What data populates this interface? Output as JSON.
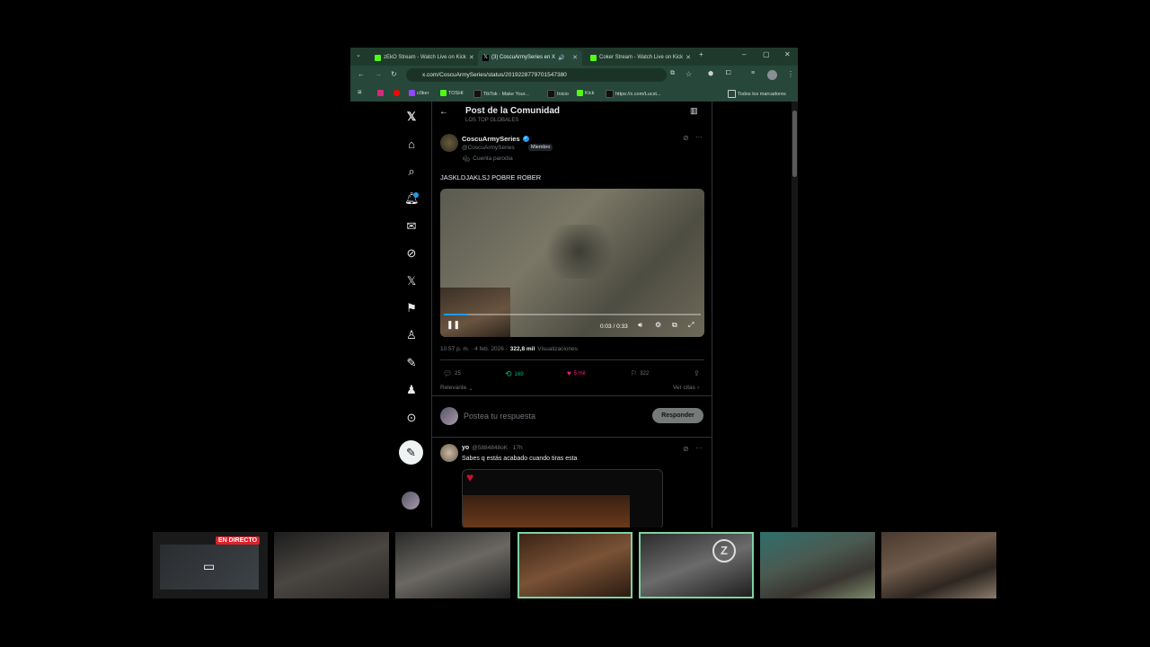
{
  "browser": {
    "tabs": [
      {
        "title": "zEkO Stream - Watch Live on Kick",
        "icon": "kick-icon",
        "active": false
      },
      {
        "title": "(3) CoscuArmySeries en X",
        "icon": "x-logo-icon",
        "active": true
      },
      {
        "title": "Coker Stream - Watch Live on Kick",
        "icon": "kick-icon",
        "active": false
      }
    ],
    "url": "x.com/CoscuArmySeries/status/2019228779701547380",
    "bookmarks": [
      "c0ker",
      "TOSHI",
      "TikTok - Make Your...",
      "Inicio",
      "Kick",
      "https://x.com/Lucst..."
    ],
    "all_bookmarks": "Todos los marcadores"
  },
  "post": {
    "header_title": "Post de la Comunidad",
    "header_subtitle": "LOS TOP GLOBALES",
    "author_name": "CoscuArmySeries",
    "author_handle": "@CoscuArmySeries",
    "member_badge": "Miembro",
    "parody_label": "Cuenta parodia",
    "text": "JASKLDJAKLSJ POBRE ROBER",
    "video_time": "0:03 / 0:33",
    "video_progress": 0.09,
    "timestamp": "10:57 p. m. · 4 feb. 2026 ·",
    "views_count": "322,8 mil",
    "views_label": "Visualizaciones",
    "replies": "25",
    "reposts": "169",
    "likes": "5 mil",
    "bookmarks": "322",
    "sort_label": "Relevante",
    "quotes_link": "Ver citas",
    "reply_placeholder": "Postea tu respuesta",
    "reply_button": "Responder"
  },
  "reply": {
    "author_name": "yo",
    "author_handle": "@5884848oK · 17h",
    "text": "Sabes q estás acabado cuando tiras esta"
  },
  "overlay": {
    "live_badge": "EN DIRECTO"
  },
  "colors": {
    "accent": "#1d9bf0",
    "repost": "#00ba7c",
    "like": "#f91880",
    "live": "#e0202a",
    "cam_highlight": "#7fd1a2"
  }
}
